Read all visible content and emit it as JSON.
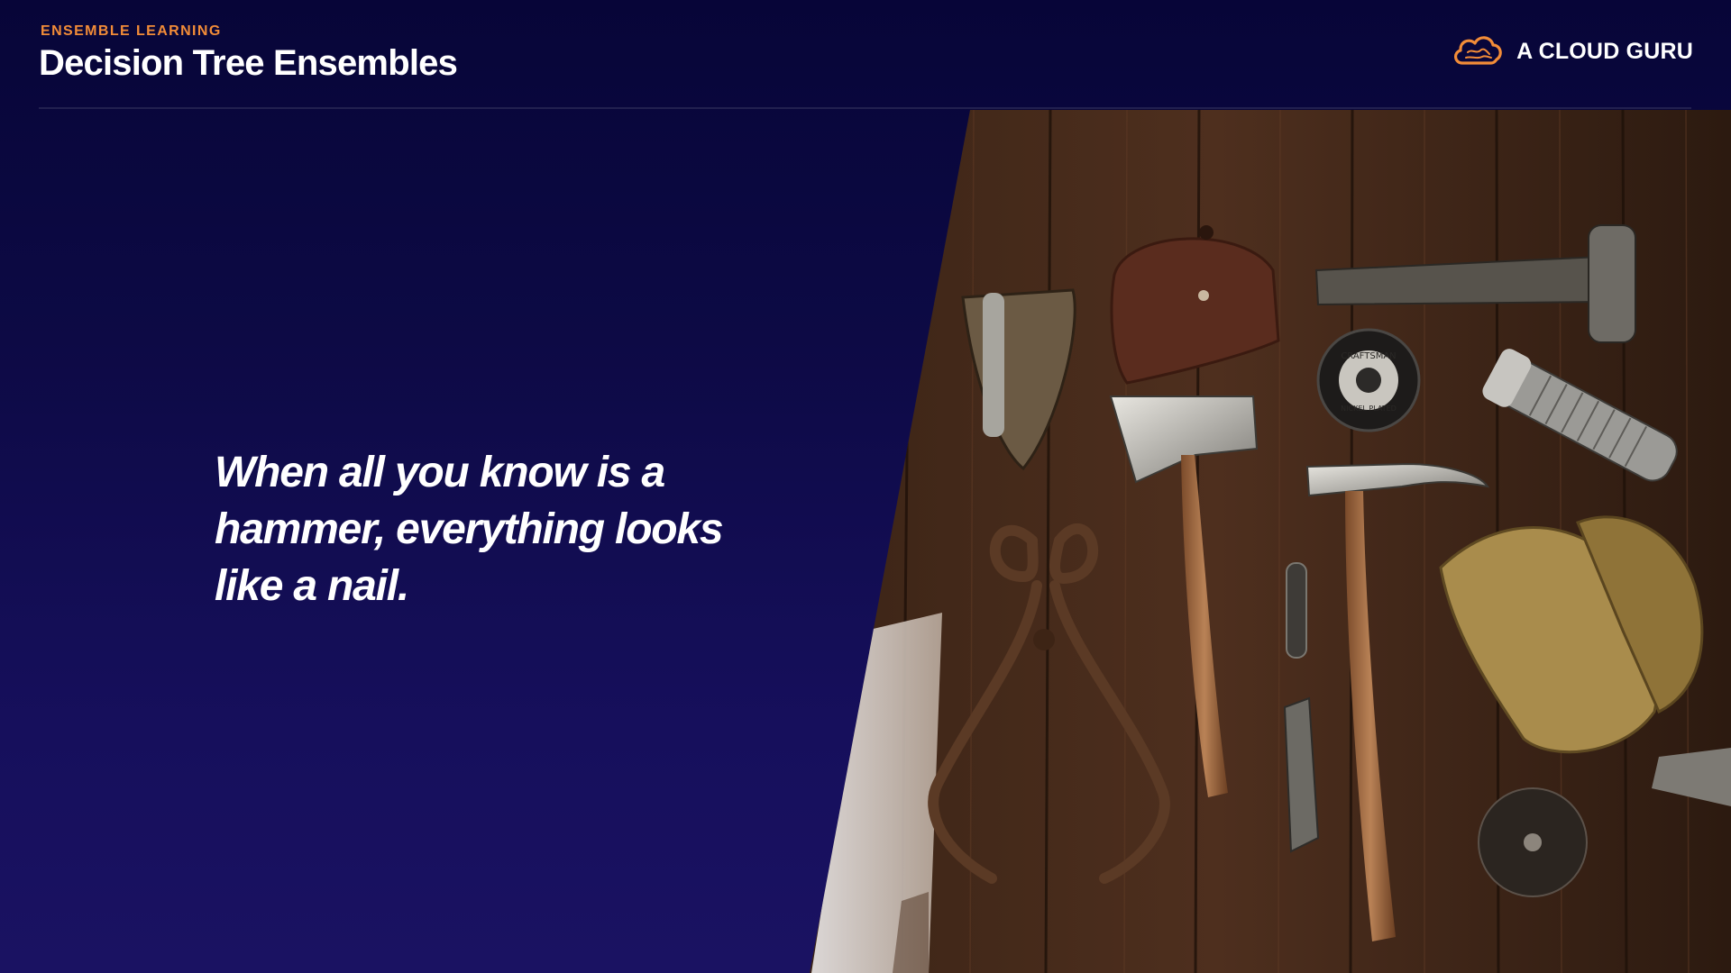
{
  "header": {
    "eyebrow": "ENSEMBLE LEARNING",
    "title": "Decision Tree Ensembles"
  },
  "brand": {
    "name": "A CLOUD GURU",
    "icon": "cloud-logo-icon",
    "accent": "#f28c38"
  },
  "quote": {
    "text": "When all you know is a hammer, everything looks like a nail."
  },
  "photo": {
    "tape_lines": [
      "CRAFTSMAN",
      "NICKEL PLATED"
    ]
  },
  "colors": {
    "background_top": "#070538",
    "background_bottom": "#1a1262",
    "wood": "#4a2c1c",
    "text": "#ffffff"
  }
}
